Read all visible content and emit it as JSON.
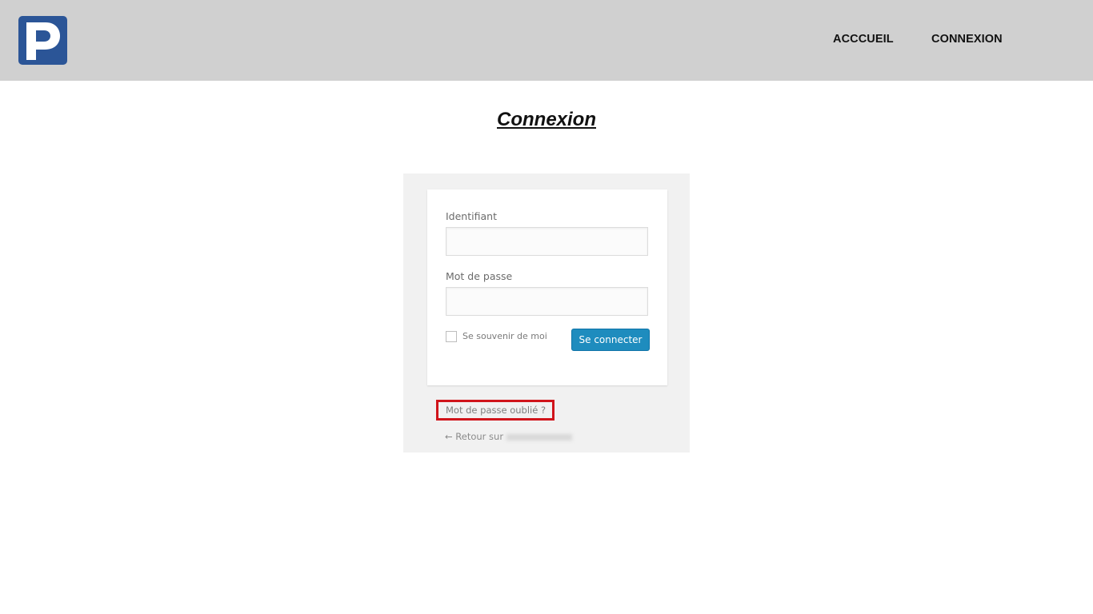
{
  "header": {
    "logo_letter": "P",
    "nav": {
      "home": "ACCCUEIL",
      "login": "CONNEXION"
    }
  },
  "main": {
    "title": "Connexion"
  },
  "login_form_image": {
    "username_label": "Identifiant",
    "password_label": "Mot de passe",
    "remember_label": "Se souvenir de moi",
    "submit_label": "Se connecter",
    "forgot_link": "Mot de passe oublié ?",
    "back_link": "← Retour sur"
  },
  "colors": {
    "header_bg": "#d0d0d0",
    "logo_bg": "#2b5597",
    "submit_button": "#1e8cbe",
    "highlight_box": "#d0141b"
  },
  "icons": {
    "logo": "parking-p-icon"
  }
}
